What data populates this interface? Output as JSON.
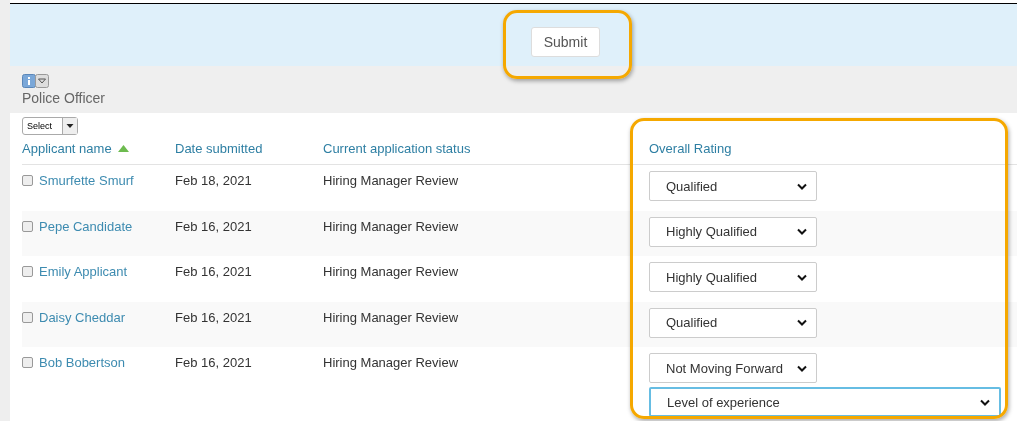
{
  "submit_button": {
    "label": "Submit"
  },
  "job": {
    "title": "Police Officer"
  },
  "bulk_select": {
    "label": "Select"
  },
  "table": {
    "columns": [
      {
        "label": "Applicant name",
        "sorted": true
      },
      {
        "label": "Date submitted",
        "sorted": false
      },
      {
        "label": "Current application status",
        "sorted": false
      },
      {
        "label": "Overall Rating",
        "sorted": false
      }
    ],
    "rows": [
      {
        "checked": false,
        "name": "Smurfette Smurf",
        "date": "Feb 18, 2021",
        "status": "Hiring Manager Review",
        "rating": "Qualified"
      },
      {
        "checked": false,
        "name": "Pepe Candidate",
        "date": "Feb 16, 2021",
        "status": "Hiring Manager Review",
        "rating": "Highly Qualified"
      },
      {
        "checked": false,
        "name": "Emily Applicant",
        "date": "Feb 16, 2021",
        "status": "Hiring Manager Review",
        "rating": "Highly Qualified"
      },
      {
        "checked": false,
        "name": "Daisy Cheddar",
        "date": "Feb 16, 2021",
        "status": "Hiring Manager Review",
        "rating": "Qualified"
      },
      {
        "checked": false,
        "name": "Bob Bobertson",
        "date": "Feb 16, 2021",
        "status": "Hiring Manager Review",
        "rating": "Not Moving Forward",
        "reason": "Level of experience"
      }
    ]
  }
}
